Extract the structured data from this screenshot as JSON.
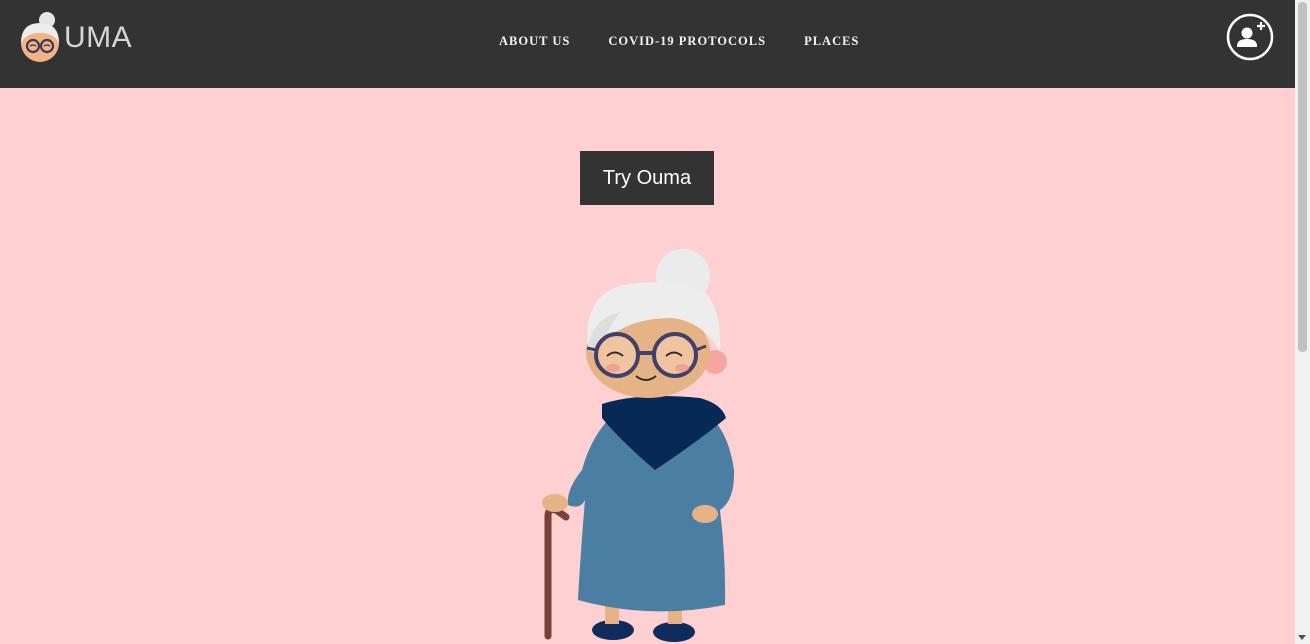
{
  "brand": {
    "name_suffix": "UMA",
    "logo_icon": "granny-face-icon"
  },
  "nav": {
    "links": [
      {
        "label": "ABOUT US"
      },
      {
        "label": "COVID-19 PROTOCOLS"
      },
      {
        "label": "PLACES"
      }
    ],
    "user_icon": "user-plus-icon"
  },
  "hero": {
    "cta_label": "Try Ouma",
    "illustration": "grandmother-with-cane"
  },
  "colors": {
    "navbar": "#333333",
    "background": "#ffd0d2",
    "button": "#333333",
    "nav_text": "#f2f2f2"
  }
}
